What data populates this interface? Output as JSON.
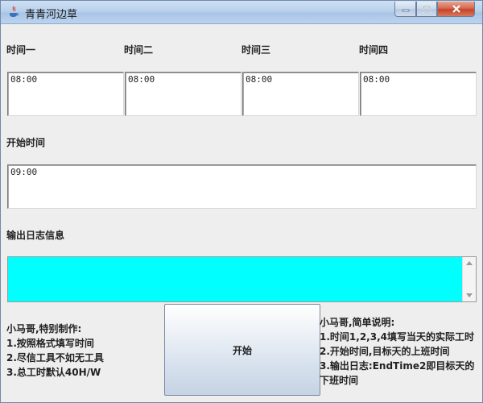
{
  "window": {
    "title": "青青河边草"
  },
  "times": {
    "labels": [
      "时间一",
      "时间二",
      "时间三",
      "时间四"
    ],
    "values": [
      "08:00",
      "08:00",
      "08:00",
      "08:00"
    ]
  },
  "start_time": {
    "label": "开始时间",
    "value": "09:00"
  },
  "log": {
    "label": "输出日志信息",
    "value": ""
  },
  "start_button": {
    "label": "开始"
  },
  "left_notes": [
    "小马哥,特别制作:",
    "1.按照格式填写时间",
    "2.尽信工具不如无工具",
    "3.总工时默认40H/W"
  ],
  "right_notes": [
    "小马哥,简单说明:",
    "1.时间1,2,3,4填写当天的实际工时",
    "2.开始时间,目标天的上班时间",
    "3.输出日志:EndTime2即目标天的下班时间"
  ],
  "colors": {
    "log_background": "#00ffff",
    "window_background": "#eeeeee"
  }
}
